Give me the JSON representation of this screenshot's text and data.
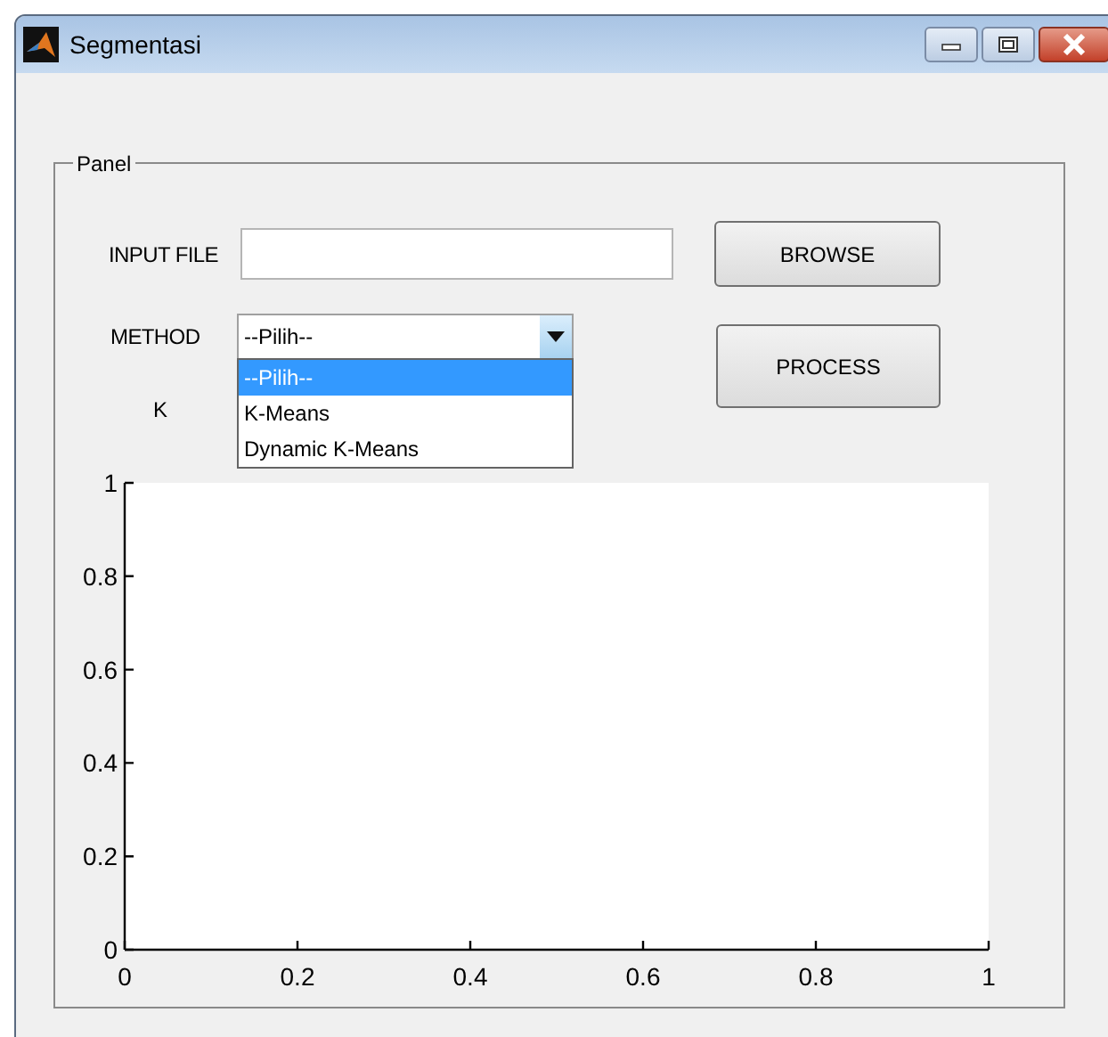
{
  "window": {
    "title": "Segmentasi"
  },
  "panel": {
    "title": "Panel",
    "input_file": {
      "label": "INPUT FILE"
    },
    "browse_button": "BROWSE",
    "method": {
      "label": "METHOD",
      "value": "--Pilih--",
      "expanded": true,
      "options": [
        {
          "label": "--Pilih--",
          "selected": true
        },
        {
          "label": "K-Means",
          "selected": false
        },
        {
          "label": "Dynamic K-Means",
          "selected": false
        }
      ]
    },
    "process_button": "PROCESS",
    "k_label": "K",
    "axes": {
      "chart_data": {
        "type": "line",
        "xlim": [
          0,
          1
        ],
        "ylim": [
          0,
          1
        ],
        "xticks": [
          0,
          0.2,
          0.4,
          0.6,
          0.8,
          1
        ],
        "yticks": [
          0,
          0.2,
          0.4,
          0.6,
          0.8,
          1
        ]
      }
    }
  }
}
